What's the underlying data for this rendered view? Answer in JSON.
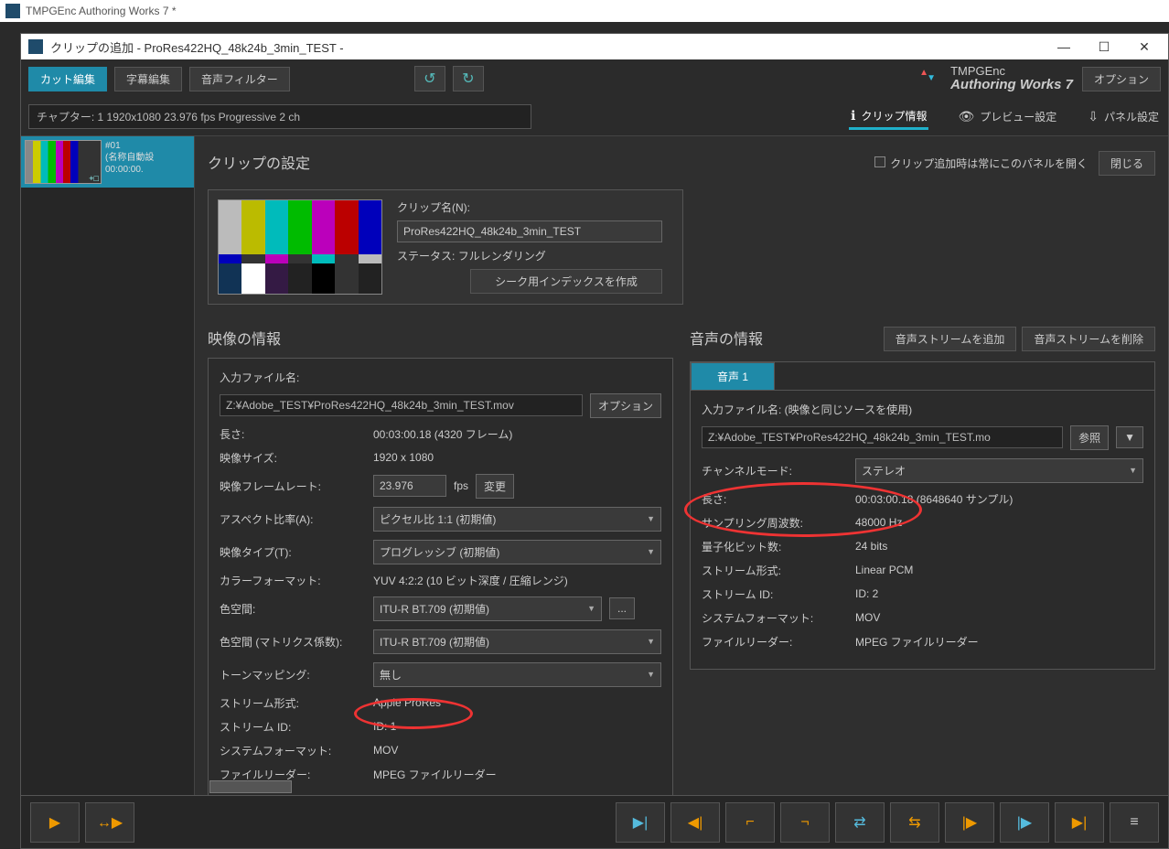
{
  "outerTitle": "TMPGEnc Authoring Works 7 *",
  "innerTitle": "クリップの追加 - ProRes422HQ_48k24b_3min_TEST -",
  "toolbar": {
    "cutEdit": "カット編集",
    "subtitleEdit": "字幕編集",
    "audioFilter": "音声フィルター",
    "option": "オプション"
  },
  "logo": {
    "line1": "TMPGEnc",
    "line2": "Authoring Works 7"
  },
  "chapterInfo": "チャプター: 1  1920x1080 23.976 fps Progressive  2 ch",
  "infoTabs": {
    "clipInfo": "クリップ情報",
    "previewSettings": "プレビュー設定",
    "panelSettings": "パネル設定"
  },
  "leftClip": {
    "id": "#01",
    "name": "(名称自動設",
    "time": "00:00:00."
  },
  "section": {
    "title": "クリップの設定",
    "showPanelCheck": "クリップ追加時は常にこのパネルを開く",
    "close": "閉じる"
  },
  "clipPanel": {
    "nameLabel": "クリップ名(N):",
    "nameValue": "ProRes422HQ_48k24b_3min_TEST",
    "statusLabel": "ステータス:",
    "statusValue": "フルレンダリング",
    "seekBtn": "シーク用インデックスを作成"
  },
  "video": {
    "title": "映像の情報",
    "inputLabel": "入力ファイル名:",
    "inputValue": "Z:¥Adobe_TEST¥ProRes422HQ_48k24b_3min_TEST.mov",
    "optionBtn": "オプション",
    "lengthLabel": "長さ:",
    "lengthValue": "00:03:00.18 (4320 フレーム)",
    "sizeLabel": "映像サイズ:",
    "sizeValue": "1920 x 1080",
    "fpsLabel": "映像フレームレート:",
    "fpsValue": "23.976",
    "fpsUnit": "fps",
    "changeBtn": "変更",
    "aspectLabel": "アスペクト比率(A):",
    "aspectValue": "ピクセル比 1:1 (初期値)",
    "typeLabel": "映像タイプ(T):",
    "typeValue": "プログレッシブ (初期値)",
    "colorFmtLabel": "カラーフォーマット:",
    "colorFmtValue": "YUV 4:2:2 (10 ビット深度 / 圧縮レンジ)",
    "colorSpaceLabel": "色空間:",
    "colorSpaceValue": "ITU-R BT.709 (初期値)",
    "dotsBtn": "...",
    "matrixLabel": "色空間 (マトリクス係数):",
    "matrixValue": "ITU-R BT.709 (初期値)",
    "toneLabel": "トーンマッピング:",
    "toneValue": "無し",
    "streamFmtLabel": "ストリーム形式:",
    "streamFmtValue": "Apple ProRes",
    "streamIdLabel": "ストリーム ID:",
    "streamIdValue": "ID: 1",
    "sysFmtLabel": "システムフォーマット:",
    "sysFmtValue": "MOV",
    "readerLabel": "ファイルリーダー:",
    "readerValue": "MPEG ファイルリーダー"
  },
  "audio": {
    "title": "音声の情報",
    "addStream": "音声ストリームを追加",
    "delStream": "音声ストリームを削除",
    "tab1": "音声 1",
    "inputLabel": "入力ファイル名: (映像と同じソースを使用)",
    "inputValue": "Z:¥Adobe_TEST¥ProRes422HQ_48k24b_3min_TEST.mo",
    "browseBtn": "参照",
    "dropBtn": "▼",
    "chModeLabel": "チャンネルモード:",
    "chModeValue": "ステレオ",
    "lengthLabel": "長さ:",
    "lengthValue": "00:03:00.18 (8648640 サンプル)",
    "sampleLabel": "サンプリング周波数:",
    "sampleValue": "48000 Hz",
    "bitsLabel": "量子化ビット数:",
    "bitsValue": "24 bits",
    "streamFmtLabel": "ストリーム形式:",
    "streamFmtValue": "Linear PCM",
    "streamIdLabel": "ストリーム ID:",
    "streamIdValue": "ID: 2",
    "sysFmtLabel": "システムフォーマット:",
    "sysFmtValue": "MOV",
    "readerLabel": "ファイルリーダー:",
    "readerValue": "MPEG ファイルリーダー"
  }
}
